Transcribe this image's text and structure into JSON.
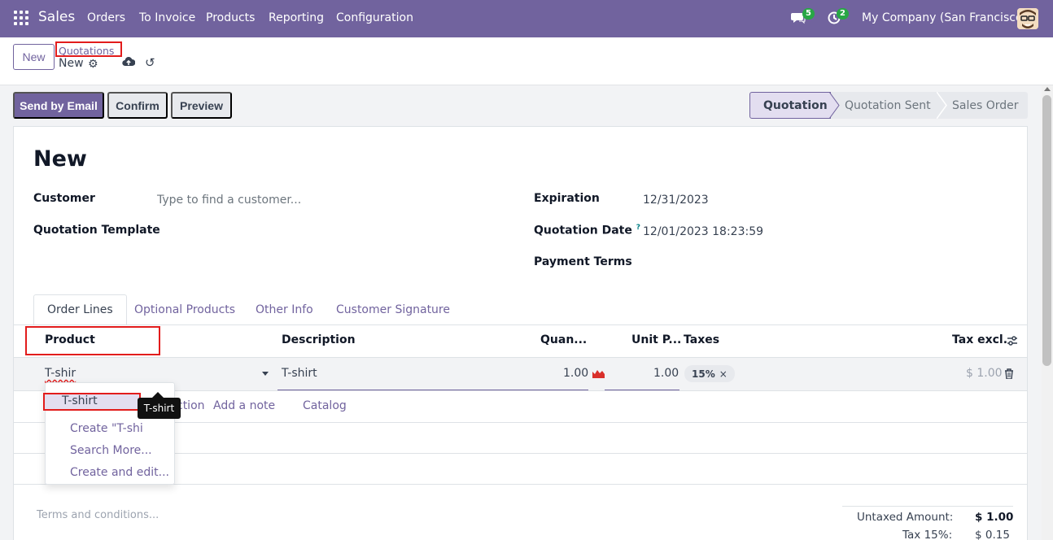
{
  "navbar": {
    "app_name": "Sales",
    "menu": [
      "Orders",
      "To Invoice",
      "Products",
      "Reporting",
      "Configuration"
    ],
    "messages_count": "5",
    "activities_count": "2",
    "company": "My Company (San Francisco)"
  },
  "control_panel": {
    "new_label": "New",
    "breadcrumb": "Quotations",
    "record_name": "New"
  },
  "actions": {
    "send_email": "Send by Email",
    "confirm": "Confirm",
    "preview": "Preview"
  },
  "statusbar": [
    "Quotation",
    "Quotation Sent",
    "Sales Order"
  ],
  "form": {
    "title": "New",
    "customer_label": "Customer",
    "customer_placeholder": "Type to find a customer...",
    "template_label": "Quotation Template",
    "expiration_label": "Expiration",
    "expiration_value": "12/31/2023",
    "quotation_date_label": "Quotation Date",
    "help_mark": "?",
    "quotation_date_value": "12/01/2023 18:23:59",
    "payment_terms_label": "Payment Terms"
  },
  "tabs": [
    "Order Lines",
    "Optional Products",
    "Other Info",
    "Customer Signature"
  ],
  "table": {
    "headers": {
      "product": "Product",
      "description": "Description",
      "quantity": "Quan...",
      "unit_price": "Unit P...",
      "taxes": "Taxes",
      "tax_excl": "Tax excl."
    },
    "line": {
      "product_input": "T-shir",
      "description": "T-shirt",
      "quantity": "1.00",
      "unit_price": "1.00",
      "tax": "15%",
      "tax_remove": "×",
      "subtotal": "$ 1.00"
    },
    "add_links": {
      "section_fragment": "ction",
      "note": "Add a note",
      "catalog": "Catalog"
    }
  },
  "dropdown": {
    "items": [
      "T-shirt",
      "Create \"T-shi",
      "Search More...",
      "Create and edit..."
    ]
  },
  "tooltip": "T-shirt",
  "footer": {
    "terms_placeholder": "Terms and conditions...",
    "untaxed_label": "Untaxed Amount:",
    "untaxed_value": "$ 1.00",
    "tax_label": "Tax 15%:",
    "tax_value": "$ 0.15"
  },
  "colors": {
    "brand": "#71639e",
    "highlight": "#e21c1c",
    "badge": "#28a745"
  }
}
